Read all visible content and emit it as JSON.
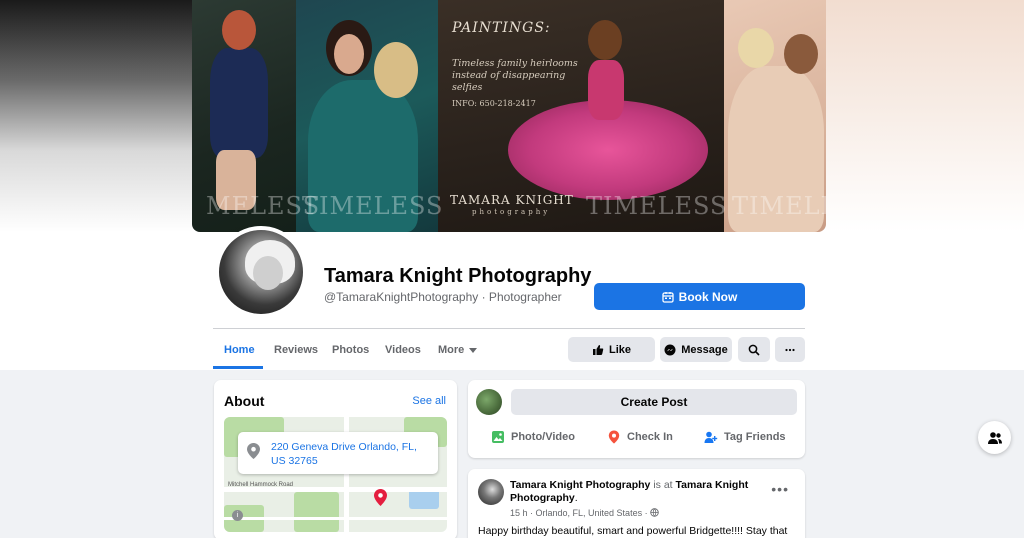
{
  "cover": {
    "paintings_title": "PAINTINGS:",
    "paintings_sub": "Timeless family heirlooms instead of disappearing selfies",
    "info": "INFO: 650-218-2417",
    "brand": "TAMARA KNIGHT",
    "brand_sub": "photography",
    "watermarks": [
      "MELESS",
      "TIMELESS",
      "TIMELESS",
      "TIMELE"
    ]
  },
  "profile": {
    "name": "Tamara Knight Photography",
    "handle": "@TamaraKnightPhotography · Photographer",
    "book_label": "Book Now"
  },
  "tabs": [
    {
      "label": "Home",
      "active": true
    },
    {
      "label": "Reviews"
    },
    {
      "label": "Photos"
    },
    {
      "label": "Videos"
    },
    {
      "label": "More"
    }
  ],
  "actions": {
    "like": "Like",
    "message": "Message"
  },
  "about": {
    "title": "About",
    "see_all": "See all",
    "address": "220 Geneva Drive Orlando, FL, US 32765",
    "map_road_label": "Mitchell Hammock Road",
    "map_badge": "i"
  },
  "create_post": {
    "button": "Create Post",
    "photo_video": "Photo/Video",
    "check_in": "Check In",
    "tag_friends": "Tag Friends"
  },
  "post": {
    "author": "Tamara Knight Photography",
    "is_at": "is at",
    "location_name": "Tamara Knight Photography",
    "meta": "15 h · Orlando, FL, United States ·",
    "dots": "•••",
    "text": "Happy birthday beautiful, smart and powerful Bridgette!!!! Stay that"
  },
  "colors": {
    "accent": "#1b74e4",
    "secondary_text": "#65676b",
    "button_gray": "#e4e6eb",
    "background": "#f0f2f5"
  }
}
